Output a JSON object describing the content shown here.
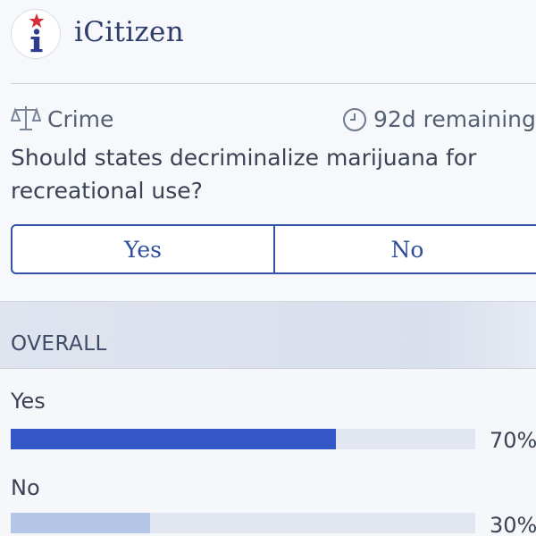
{
  "header": {
    "app_title": "iCitizen",
    "logo_icon": "info-star-logo"
  },
  "question_card": {
    "category": "Crime",
    "category_icon": "scales-icon",
    "remaining": "92d remaining",
    "remaining_icon": "clock-icon",
    "question": "Should states decriminalize marijuana for recreational use?",
    "options": [
      "Yes",
      "No"
    ]
  },
  "results": {
    "section_label": "OVERALL",
    "items": [
      {
        "label": "Yes",
        "percent_label": "70%",
        "fraction": 0.7,
        "color": "#3558c8"
      },
      {
        "label": "No",
        "percent_label": "30%",
        "fraction": 0.3,
        "color": "#b6c6e6"
      }
    ]
  },
  "colors": {
    "accent": "#3352a3",
    "bar_track": "#e1e6f0"
  }
}
